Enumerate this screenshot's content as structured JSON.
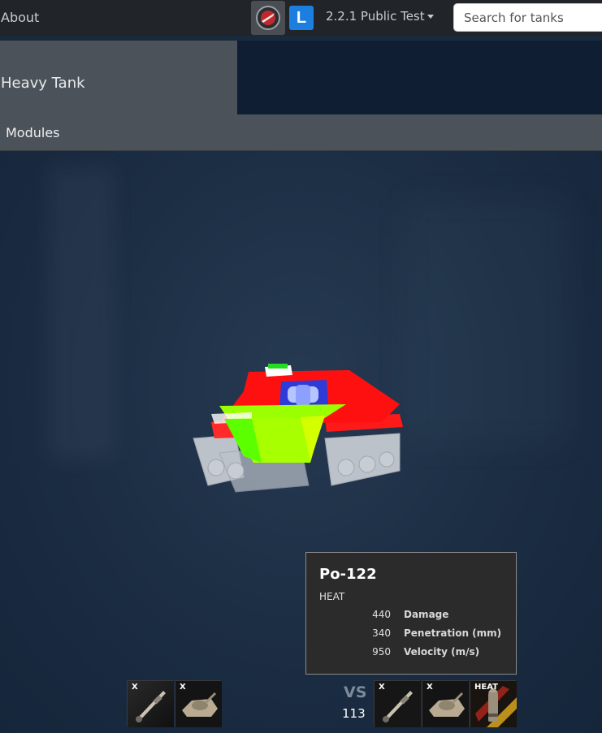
{
  "navbar": {
    "about_label": "About",
    "version_label": "2.2.1 Public Test",
    "l_icon_letter": "L",
    "search_placeholder": "Search for tanks"
  },
  "header": {
    "tank_class": "Heavy Tank"
  },
  "modules_bar": {
    "label": "Modules"
  },
  "tooltip": {
    "title": "Po-122",
    "shell_type": "HEAT",
    "stats": [
      {
        "value": "440",
        "label": "Damage"
      },
      {
        "value": "340",
        "label": "Penetration (mm)"
      },
      {
        "value": "950",
        "label": "Velocity (m/s)"
      }
    ]
  },
  "bottom": {
    "left_slots": [
      {
        "icon": "gun-icon",
        "mark": "X"
      },
      {
        "icon": "turret-icon",
        "mark": "X"
      }
    ],
    "vs_label": "VS",
    "vs_value": "113",
    "right_slots": [
      {
        "icon": "gun-icon",
        "mark": "X"
      },
      {
        "icon": "turret-icon",
        "mark": "X"
      },
      {
        "icon": "heat-shell-icon",
        "mark": "HEAT"
      }
    ]
  },
  "colors": {
    "navbar_bg": "#212529",
    "header_gray": "#4b5259",
    "header_navy": "#0f1e33",
    "accent_blue": "#1c7fe0"
  }
}
